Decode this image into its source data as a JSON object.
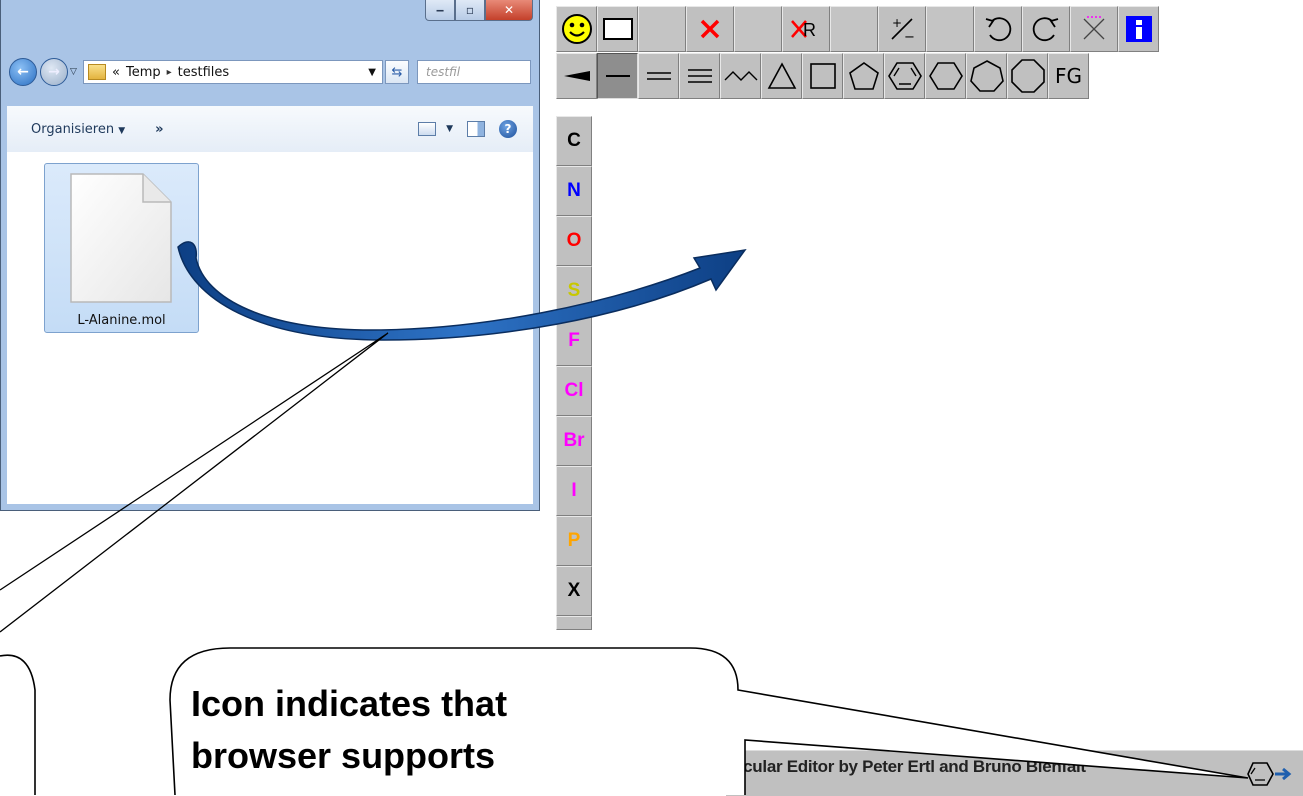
{
  "explorer": {
    "address": {
      "prefix": "«",
      "crumbs": [
        "Temp",
        "testfiles"
      ]
    },
    "search_placeholder": "testfil",
    "toolbar": {
      "organize_label": "Organisieren",
      "more_label": "»"
    },
    "files": [
      {
        "name": "L-Alanine.mol",
        "icon": "document-icon",
        "selected": true
      }
    ],
    "caption_buttons": [
      "minimize",
      "maximize",
      "close"
    ]
  },
  "editor": {
    "top_row": [
      "smiley-icon",
      "rectangle-icon",
      "",
      "delete-icon",
      "",
      "R-group-icon",
      "",
      "charge-icon",
      "",
      "undo-icon",
      "redo-icon",
      "clear-icon",
      "info-icon"
    ],
    "second_row_fg_label": "FG",
    "elements": [
      {
        "symbol": "C",
        "color": "#000000"
      },
      {
        "symbol": "N",
        "color": "#0000ff"
      },
      {
        "symbol": "O",
        "color": "#ff0000"
      },
      {
        "symbol": "S",
        "color": "#c8c800"
      },
      {
        "symbol": "F",
        "color": "#ff00ff"
      },
      {
        "symbol": "Cl",
        "color": "#ff00ff"
      },
      {
        "symbol": "Br",
        "color": "#ff00ff"
      },
      {
        "symbol": "I",
        "color": "#ff00ff"
      },
      {
        "symbol": "P",
        "color": "#ffa500"
      },
      {
        "symbol": "X",
        "color": "#000000"
      }
    ],
    "status_text": "ecular Editor by Peter Ertl and Bruno Bienfait"
  },
  "callout": {
    "lines": [
      "Icon indicates that",
      "browser supports"
    ]
  },
  "colors": {
    "arrow_fill": "#1f5fae",
    "info_blue": "#0000ff",
    "delete_red": "#ff0000"
  }
}
